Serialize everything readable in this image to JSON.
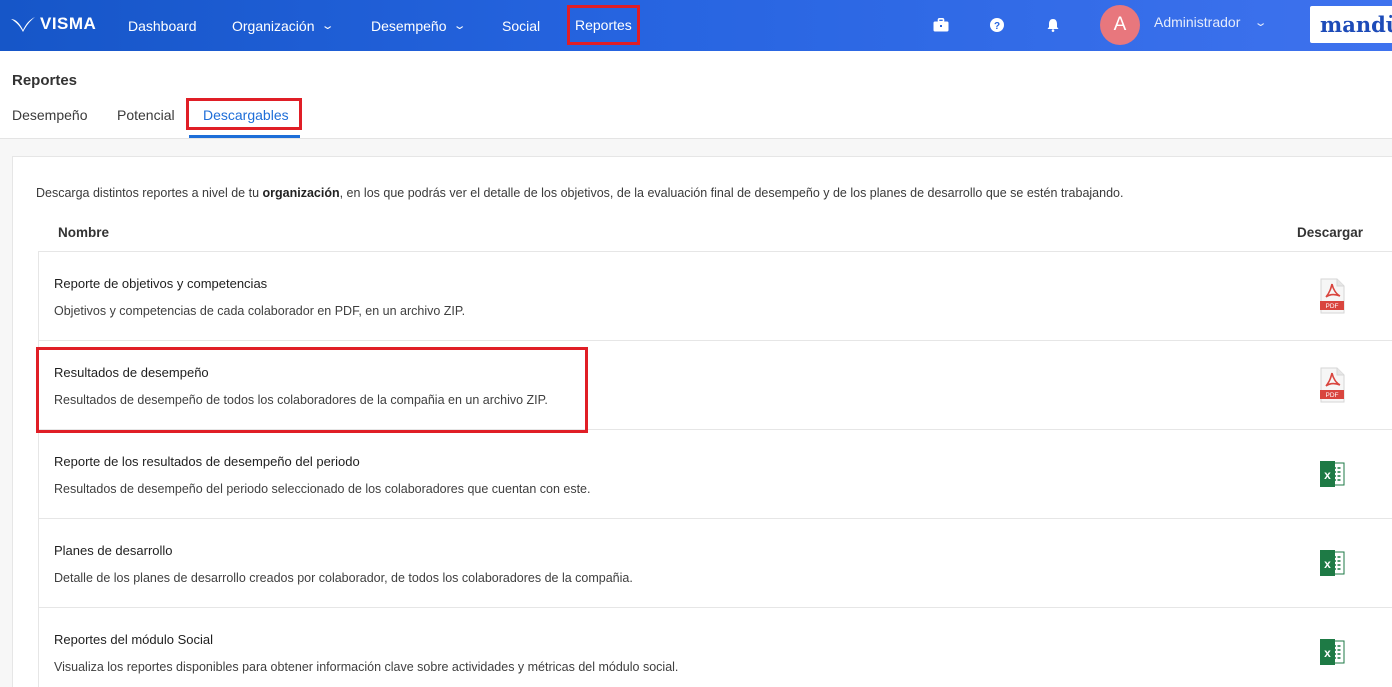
{
  "nav": {
    "logo_text": "VISMA",
    "items": [
      {
        "label": "Dashboard",
        "dropdown": false
      },
      {
        "label": "Organización",
        "dropdown": true
      },
      {
        "label": "Desempeño",
        "dropdown": true
      },
      {
        "label": "Social",
        "dropdown": false
      },
      {
        "label": "Reportes",
        "dropdown": false
      }
    ],
    "icons": [
      "briefcase-icon",
      "help-icon",
      "bell-icon"
    ],
    "user_initial": "A",
    "user_name": "Administrador",
    "brand": "mandü"
  },
  "page": {
    "title": "Reportes",
    "tabs": [
      {
        "label": "Desempeño",
        "active": false
      },
      {
        "label": "Potencial",
        "active": false
      },
      {
        "label": "Descargables",
        "active": true
      }
    ]
  },
  "content": {
    "desc_before": "Descarga distintos reportes a nivel de tu ",
    "desc_bold": "organización",
    "desc_after": ", en los que podrás ver el detalle de los objetivos, de la evaluación final de desempeño y de los planes de desarrollo que se estén trabajando.",
    "col_name": "Nombre",
    "col_download": "Descargar",
    "reports": [
      {
        "title": "Reporte de objetivos y competencias",
        "description": "Objetivos y competencias de cada colaborador en PDF, en un archivo ZIP.",
        "file_type": "pdf"
      },
      {
        "title": "Resultados de desempeño",
        "description": "Resultados de desempeño de todos los colaboradores de la compañia en un archivo ZIP.",
        "file_type": "pdf"
      },
      {
        "title": "Reporte de los resultados de desempeño del periodo",
        "description": "Resultados de desempeño del periodo seleccionado de los colaboradores que cuentan con este.",
        "file_type": "excel"
      },
      {
        "title": "Planes de desarrollo",
        "description": "Detalle de los planes de desarrollo creados por colaborador, de todos los colaboradores de la compañia.",
        "file_type": "excel"
      },
      {
        "title": "Reportes del módulo Social",
        "description": "Visualiza los reportes disponibles para obtener información clave sobre actividades y métricas del módulo social.",
        "file_type": "excel"
      }
    ],
    "pdf_badge": "PDF",
    "excel_badge": "x"
  },
  "colors": {
    "nav_blue": "#2664e0",
    "highlight_red": "#e01e26",
    "tab_active": "#1e6ed8",
    "pdf_red": "#d9453e",
    "excel_green": "#1e7a45"
  }
}
